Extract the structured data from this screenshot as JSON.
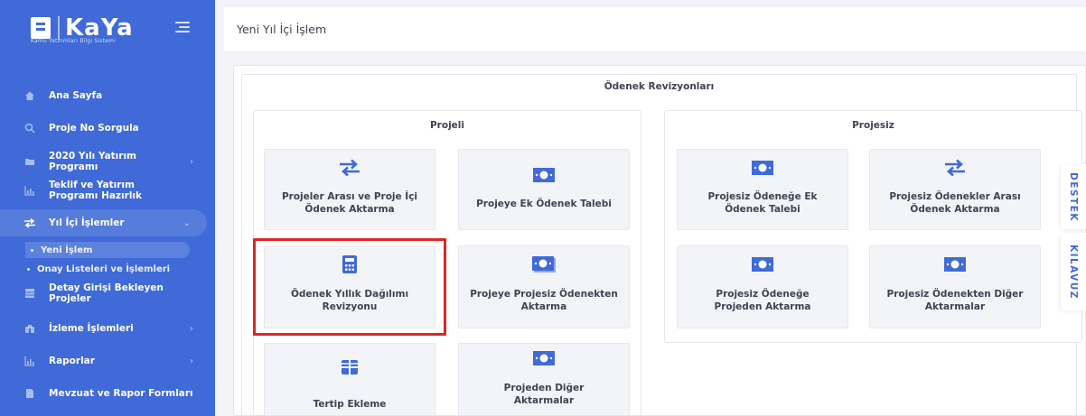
{
  "brand": {
    "name": "KaYa",
    "subtitle": "Kamu Yatırımları Bilgi Sistemi"
  },
  "sidebar": {
    "items": [
      {
        "label": "Ana Sayfa",
        "icon": "home-icon"
      },
      {
        "label": "Proje No Sorgula",
        "icon": "search-icon"
      },
      {
        "label": "2020 Yılı Yatırım Programı",
        "icon": "folder-icon"
      },
      {
        "label": "Teklif ve Yatırım Programı Hazırlık",
        "icon": "chart-icon"
      },
      {
        "label": "Yıl İçi İşlemler",
        "icon": "transfer-icon"
      },
      {
        "label": "Detay Girişi Bekleyen Projeler",
        "icon": "table-icon"
      },
      {
        "label": "İzleme İşlemleri",
        "icon": "binoculars-icon"
      },
      {
        "label": "Raporlar",
        "icon": "chart-icon"
      },
      {
        "label": "Mevzuat ve Rapor Formları",
        "icon": "document-icon"
      }
    ],
    "subitems": [
      {
        "label": "Yeni İşlem"
      },
      {
        "label": "Onay Listeleri ve İşlemleri"
      }
    ]
  },
  "header": {
    "title": "Yeni Yıl İçi İşlem"
  },
  "main": {
    "section_title": "Ödenek Revizyonları",
    "groups": [
      {
        "title": "Projeli",
        "tiles": [
          {
            "label": "Projeler Arası ve Proje İçi Ödenek Aktarma",
            "icon": "transfer-icon"
          },
          {
            "label": "Projeye Ek Ödenek Talebi",
            "icon": "money-icon"
          },
          {
            "label": "Ödenek Yıllık Dağılımı Revizyonu",
            "icon": "calculator-icon"
          },
          {
            "label": "Projeye Projesiz Ödenekten Aktarma",
            "icon": "money-multiple-icon"
          },
          {
            "label": "Tertip Ekleme",
            "icon": "grid-icon"
          },
          {
            "label": "Projeden Diğer Aktarmalar",
            "icon": "money-icon"
          }
        ]
      },
      {
        "title": "Projesiz",
        "tiles": [
          {
            "label": "Projesiz Ödeneğe Ek Ödenek Talebi",
            "icon": "money-icon"
          },
          {
            "label": "Projesiz Ödenekler Arası Ödenek Aktarma",
            "icon": "transfer-icon"
          },
          {
            "label": "Projesiz Ödeneğe Projeden Aktarma",
            "icon": "money-icon"
          },
          {
            "label": "Projesiz Ödenekten Diğer Aktarmalar",
            "icon": "money-icon"
          }
        ]
      }
    ]
  },
  "side_tabs": {
    "support": "DESTEK",
    "guide": "KILAVUZ"
  },
  "colors": {
    "primary": "#3f6ad8",
    "highlight": "#e02424",
    "tile_bg": "#f3f4f7"
  }
}
